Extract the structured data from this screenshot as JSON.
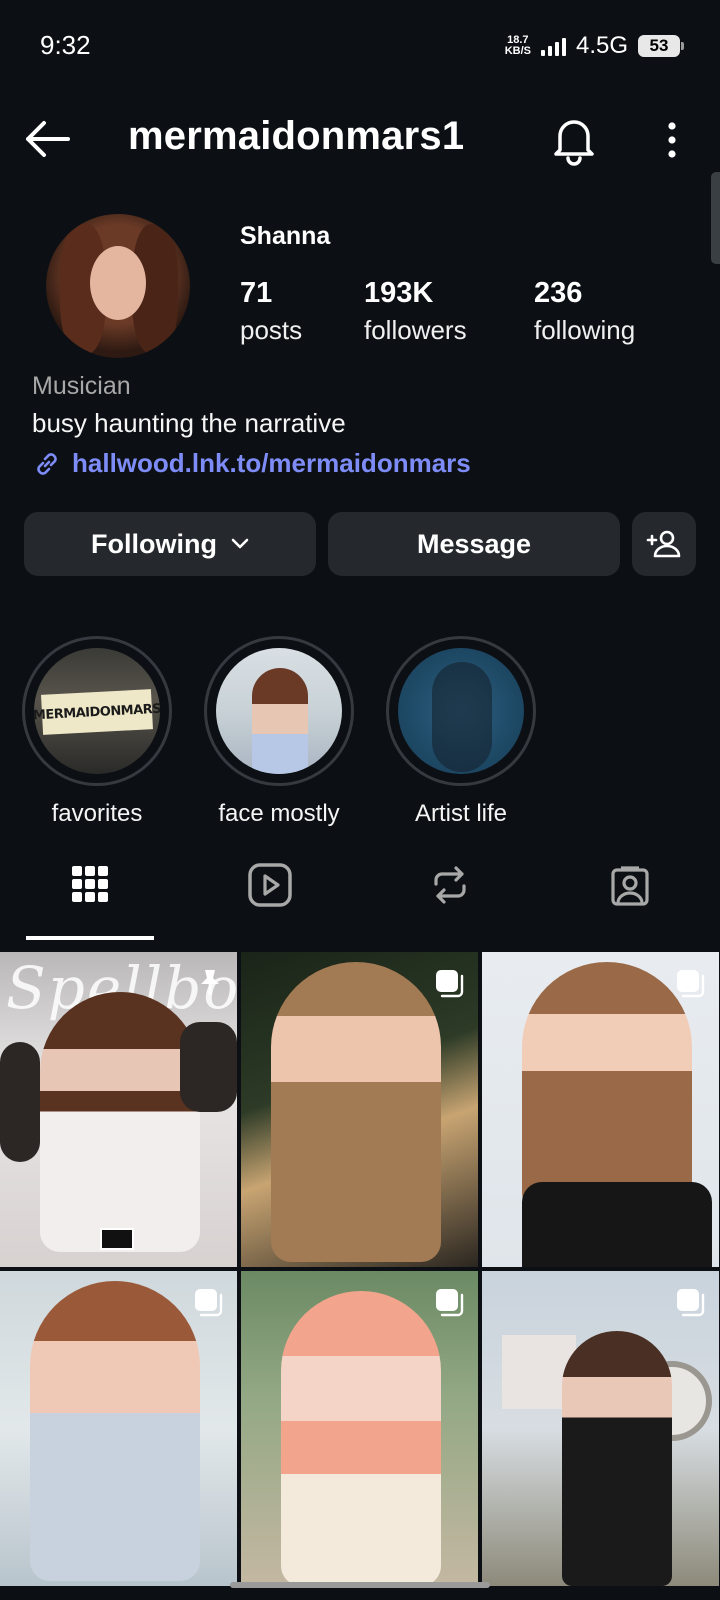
{
  "status_bar": {
    "time": "9:32",
    "net_speed_value": "18.7",
    "net_speed_unit": "KB/S",
    "network_type": "4.5G",
    "battery": "53"
  },
  "header": {
    "username": "mermaidonmars1"
  },
  "profile": {
    "display_name": "Shanna",
    "stats": [
      {
        "value": "71",
        "label": "posts"
      },
      {
        "value": "193K",
        "label": "followers"
      },
      {
        "value": "236",
        "label": "following"
      }
    ],
    "category": "Musician",
    "bio": "busy haunting the narrative",
    "link": "hallwood.lnk.to/mermaidonmars"
  },
  "actions": {
    "following_label": "Following",
    "message_label": "Message"
  },
  "highlights": [
    {
      "label": "favorites",
      "sign_text": "MERMAIDONMARS"
    },
    {
      "label": "face mostly"
    },
    {
      "label": "Artist life"
    }
  ],
  "tabs": [
    {
      "icon": "grid-icon",
      "active": true
    },
    {
      "icon": "reels-icon",
      "active": false
    },
    {
      "icon": "reposts-icon",
      "active": false
    },
    {
      "icon": "tagged-icon",
      "active": false
    }
  ],
  "posts": [
    {
      "pinned": true,
      "overlay_text": "Spellbook",
      "type": "pinned-post"
    },
    {
      "pinned": false,
      "type": "carousel"
    },
    {
      "pinned": false,
      "type": "carousel"
    },
    {
      "pinned": false,
      "type": "carousel"
    },
    {
      "pinned": false,
      "type": "carousel"
    },
    {
      "pinned": false,
      "type": "carousel"
    }
  ],
  "colors": {
    "background": "#0c1014",
    "button": "#25292e",
    "link": "#7e8cf7",
    "secondary_text": "#a8a8a8"
  }
}
